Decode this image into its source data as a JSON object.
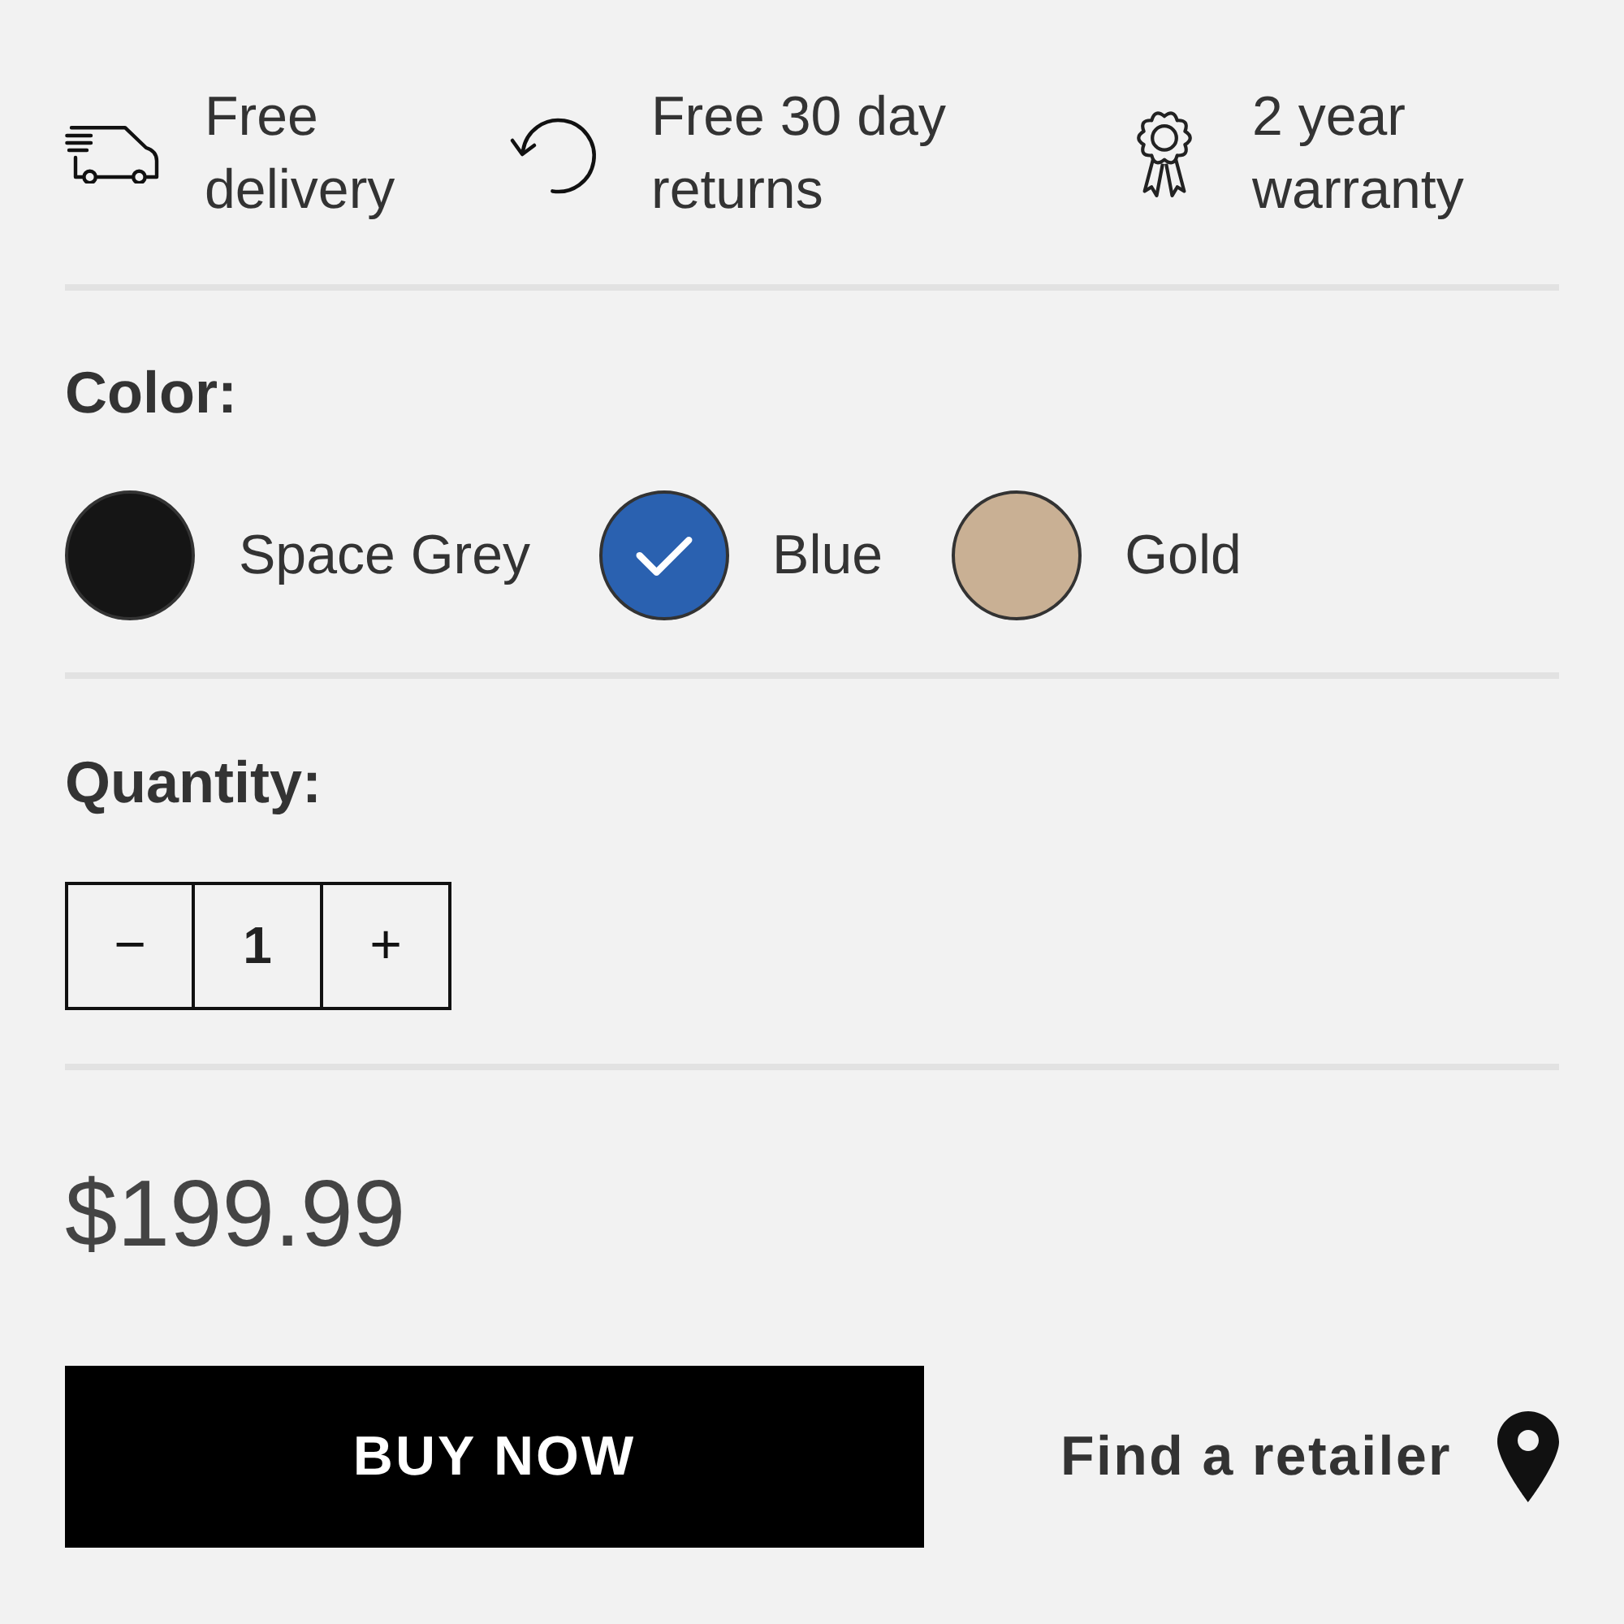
{
  "features": [
    {
      "kind": "delivery",
      "label": "Free delivery"
    },
    {
      "kind": "returns",
      "label": "Free 30 day returns"
    },
    {
      "kind": "warranty",
      "label": "2 year warranty"
    }
  ],
  "color_picker": {
    "label": "Color:",
    "options": [
      {
        "label": "Space Grey",
        "color": "#151515",
        "selected": false
      },
      {
        "label": "Blue",
        "color": "#2a61b0",
        "selected": true
      },
      {
        "label": "Gold",
        "color": "#c9b094",
        "selected": false
      }
    ]
  },
  "quantity": {
    "label": "Quantity:",
    "decrement": "−",
    "value": "1",
    "increment": "+"
  },
  "price": "$199.99",
  "buy_button": "BUY NOW",
  "retailer_link": "Find a retailer"
}
